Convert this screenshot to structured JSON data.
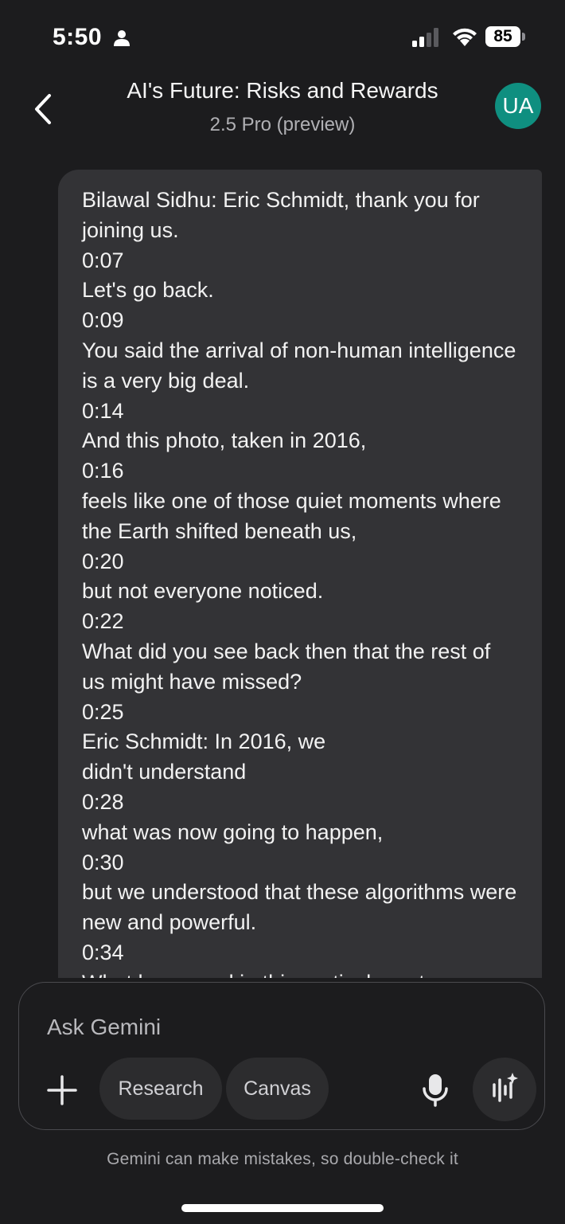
{
  "status_bar": {
    "time": "5:50",
    "battery": "85"
  },
  "header": {
    "title": "AI's Future: Risks and Rewards",
    "model": "2.5 Pro (preview)",
    "avatar_initials": "UA"
  },
  "message": {
    "lines": [
      "Bilawal Sidhu: Eric Schmidt, thank you for joining us.",
      "0:07",
      "Let's go back.",
      "0:09",
      "You said the arrival of non-human intelligence is a very big deal.",
      "0:14",
      "And this photo, taken in 2016,",
      "0:16",
      "feels like one of those quiet moments where the Earth shifted beneath us,",
      "0:20",
      "but not everyone noticed.",
      "0:22",
      "What did you see back then that the rest of us might have missed?",
      "0:25",
      "Eric Schmidt: In 2016, we",
      "didn't understand",
      "0:28",
      "what was now going to happen,",
      "0:30",
      "but we understood that these algorithms were new and powerful.",
      "0:34",
      "What happened in this particular set"
    ]
  },
  "composer": {
    "placeholder": "Ask Gemini",
    "research_label": "Research",
    "canvas_label": "Canvas"
  },
  "disclaimer": "Gemini can make mistakes, so double-check it",
  "colors": {
    "background": "#1c1c1e",
    "bubble": "#333336",
    "avatar": "#0f8f80",
    "chip": "#2c2c2e"
  },
  "icons": [
    "person-icon",
    "cellular-signal-icon",
    "wifi-icon",
    "back-chevron-icon",
    "plus-icon",
    "microphone-icon",
    "gemini-live-icon"
  ]
}
